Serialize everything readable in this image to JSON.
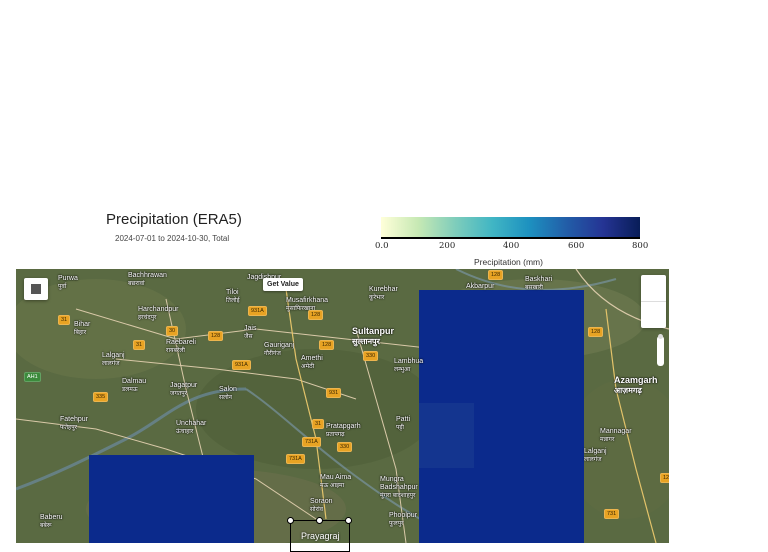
{
  "header": {
    "title": "Precipitation (ERA5)",
    "subtitle": "2024-07-01 to 2024-10-30, Total"
  },
  "colorbar": {
    "ticks": [
      "0.0",
      "200",
      "400",
      "600",
      "800"
    ],
    "label": "Precipitation (mm)",
    "min": 0,
    "max": 800,
    "colors": [
      "#ffffd9",
      "#c7e9b4",
      "#7fcdbb",
      "#41b6c4",
      "#1d91c0",
      "#225ea8",
      "#253494",
      "#081d58"
    ]
  },
  "controls": {
    "get_value_label": "Get Value"
  },
  "selection": {
    "label": "Prayagraj"
  },
  "places": [
    {
      "en": "Purwa",
      "hi": "पुर्वा"
    },
    {
      "en": "Bachhrawan",
      "hi": "बछरावां"
    },
    {
      "en": "Tiloi",
      "hi": "तिलोई"
    },
    {
      "en": "Jagdishpur",
      "hi": ""
    },
    {
      "en": "Musafirkhana",
      "hi": "मुसाफिरखाना"
    },
    {
      "en": "Kurebhar",
      "hi": "कूरेभार"
    },
    {
      "en": "Akbarpur",
      "hi": ""
    },
    {
      "en": "Baskhari",
      "hi": "बसखारी"
    },
    {
      "en": "Bihar",
      "hi": "बिहार"
    },
    {
      "en": "Harchandpur",
      "hi": "हरचंदपुर"
    },
    {
      "en": "Jais",
      "hi": "जैस"
    },
    {
      "en": "Sultanpur",
      "hi": "सुल्तानपुर"
    },
    {
      "en": "Lalganj",
      "hi": "लालगंज"
    },
    {
      "en": "Raebareli",
      "hi": "रायबरेली"
    },
    {
      "en": "Gauriganj",
      "hi": "गौरीगंज"
    },
    {
      "en": "Amethi",
      "hi": "अमेठी"
    },
    {
      "en": "Lambhua",
      "hi": "लम्भुआ"
    },
    {
      "en": "Dalmau",
      "hi": "डलमऊ"
    },
    {
      "en": "Jagatpur",
      "hi": "जगतपुर"
    },
    {
      "en": "Salon",
      "hi": "सलोन"
    },
    {
      "en": "Azamgarh",
      "hi": "आज़मगढ़"
    },
    {
      "en": "Fatehpur",
      "hi": "फतेहपुर"
    },
    {
      "en": "Unchahar",
      "hi": "ऊंचाहार"
    },
    {
      "en": "Pratapgarh",
      "hi": "प्रतापगढ़"
    },
    {
      "en": "Patti",
      "hi": "पट्टी"
    },
    {
      "en": "Mannagar",
      "hi": "मन्नागर"
    },
    {
      "en": "Lalganj",
      "hi": "लालगंज"
    },
    {
      "en": "Mau Aima",
      "hi": "मऊ आइमा"
    },
    {
      "en": "Mungra Badshahpur",
      "hi": "मुंगरा बादशाहपुर"
    },
    {
      "en": "Soraon",
      "hi": "सोरांव"
    },
    {
      "en": "Phoolpur",
      "hi": "फूलपुर"
    },
    {
      "en": "Baberu",
      "hi": "बबेरू"
    }
  ],
  "roads": [
    "128",
    "931A",
    "128",
    "30",
    "128",
    "931A",
    "128",
    "330",
    "31",
    "731A",
    "330",
    "731A",
    "931",
    "128",
    "31",
    "128",
    "335",
    "AH1",
    "31",
    "731"
  ]
}
